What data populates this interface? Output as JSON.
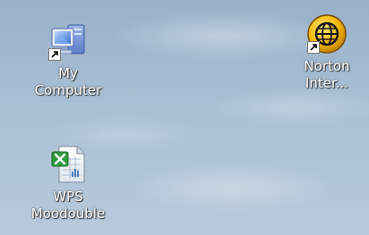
{
  "desktop": {
    "icons": [
      {
        "label": "My Computer",
        "icon": "my-computer-icon",
        "shortcut": true
      },
      {
        "label": "Norton\nInter...",
        "icon": "norton-globe-icon",
        "shortcut": true
      },
      {
        "label": "WPS\nMoodouble",
        "icon": "wps-spreadsheet-icon",
        "shortcut": false
      }
    ]
  },
  "colors": {
    "desktop_background": "#a9bfd4",
    "label_text": "#ffffff",
    "norton_yellow": "#f2b705"
  }
}
